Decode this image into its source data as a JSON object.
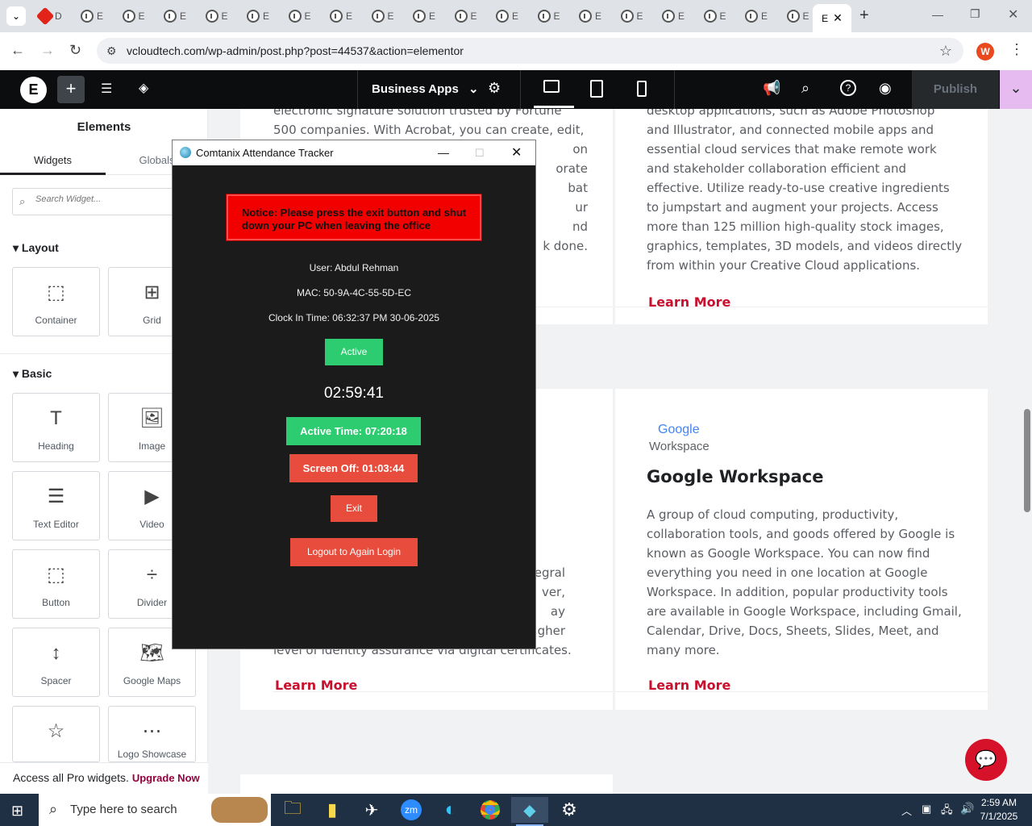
{
  "browser": {
    "tabs_favicon_label": "E",
    "first_tab_label": "D",
    "active_tab_label": "E",
    "url": "vcloudtech.com/wp-admin/post.php?post=44537&action=elementor",
    "profile_initial": "W"
  },
  "elementor": {
    "page_dropdown": "Business Apps",
    "publish": "Publish"
  },
  "panel": {
    "title": "Elements",
    "tabs": [
      "Widgets",
      "Globals"
    ],
    "search_placeholder": "Search Widget...",
    "layout_title": "Layout",
    "layout_widgets": [
      "Container",
      "Grid"
    ],
    "basic_title": "Basic",
    "basic_widgets": [
      "Heading",
      "Image",
      "Text Editor",
      "Video",
      "Button",
      "Divider",
      "Spacer",
      "Google Maps",
      "",
      "Logo Showcase"
    ],
    "promo_text": "Access all Pro widgets.",
    "promo_link": "Upgrade Now"
  },
  "canvas": {
    "card1_text": [
      "electronic signature solution trusted by Fortune",
      "500 companies. With Acrobat, you can create, edit,",
      "on",
      "orate",
      "bat",
      "ur",
      "nd",
      "k done."
    ],
    "card2_text": [
      "desktop applications, such as Adobe Photoshop",
      "and Illustrator, and connected mobile apps and",
      "essential cloud services that make remote work",
      "and stakeholder collaboration efficient and",
      "effective. Utilize ready-to-use creative ingredients",
      "to jumpstart and augment your projects. Access",
      "more than 125 million high-quality stock images,",
      "graphics, templates, 3D models, and videos directly",
      "from within your Creative Cloud applications."
    ],
    "learn_more": "Learn More",
    "card3_text": [
      "egral",
      "ver,",
      "ay",
      "gher",
      "level of identity assurance via digital certificates."
    ],
    "card4_logo_google": "Google",
    "card4_logo_workspace": "Workspace",
    "card4_title": "Google Workspace",
    "card4_text": [
      "A group of cloud computing, productivity,",
      "collaboration tools, and goods offered by Google is",
      "known as Google Workspace. You can now find",
      "everything you need in one location at Google",
      "Workspace. In addition, popular productivity tools",
      "are available in Google Workspace, including Gmail,",
      "Calendar, Drive, Docs, Sheets, Slides, Meet, and",
      "many more."
    ]
  },
  "tracker": {
    "title": "Comtanix Attendance Tracker",
    "notice": "Notice: Please press the exit button and shut down your PC when leaving the office",
    "user": "User: Abdul Rehman",
    "mac": "MAC: 50-9A-4C-55-5D-EC",
    "clock_in": "Clock In Time: 06:32:37 PM 30-06-2025",
    "status": "Active",
    "timer": "02:59:41",
    "active_time": "Active Time: 07:20:18",
    "screen_off": "Screen Off: 01:03:44",
    "exit": "Exit",
    "logout": "Logout to Again Login"
  },
  "taskbar": {
    "search_placeholder": "Type here to search",
    "time": "2:59 AM",
    "date": "7/1/2025"
  },
  "colors": {
    "accent_red": "#c8102e",
    "tracker_green": "#2ecc71",
    "tracker_red": "#e74c3c"
  }
}
